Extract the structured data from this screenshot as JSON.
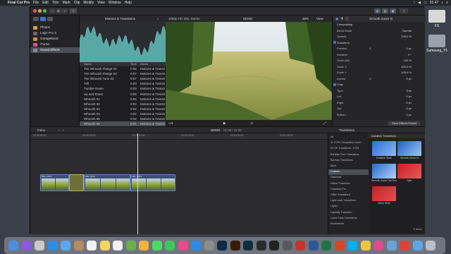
{
  "menubar": {
    "apple": "",
    "app": "Final Cut Pro",
    "items": [
      "File",
      "Edit",
      "Trim",
      "Mark",
      "Clip",
      "Modify",
      "View",
      "Window",
      "Help"
    ],
    "time": "01:47"
  },
  "toolbar": {
    "library_title": "Motions & Transitions",
    "format": "1080p HD 30p, Stereo",
    "clip_name": "DEMO",
    "zoom": "38%",
    "view": "View",
    "inspector_title": "Smooth Zoom In"
  },
  "libraries": {
    "items": [
      {
        "label": "Photos",
        "color": "#d9a23c"
      },
      {
        "label": "Logic Pro X",
        "color": "#6a6a6a"
      },
      {
        "label": "GarageBand",
        "color": "#e0892b"
      },
      {
        "label": "iTunes",
        "color": "#e64d8a"
      },
      {
        "label": "Sound Effects",
        "color": "#8a8a8a"
      }
    ],
    "selected": 4
  },
  "browser": {
    "columns": {
      "name": "Name",
      "time": "Time",
      "genre": "Genre"
    },
    "rows": [
      {
        "name": "Tire Whoosh Flange 02",
        "time": "0:05",
        "genre": "Motions & Transit"
      },
      {
        "name": "Tire Whoosh Flange 03",
        "time": "0:07",
        "genre": "Motions & Transit"
      },
      {
        "name": "Tire Whoosh Tone 02",
        "time": "0:07",
        "genre": "Motions & Transit"
      },
      {
        "name": "Trill",
        "time": "0:03",
        "genre": "Motions & Transit"
      },
      {
        "name": "Tumble Down",
        "time": "0:03",
        "genre": "Motions & Transit"
      },
      {
        "name": "Up and Down",
        "time": "0:06",
        "genre": "Motions & Transit"
      },
      {
        "name": "Whoosh 01",
        "time": "0:02",
        "genre": "Motions & Transit"
      },
      {
        "name": "Whoosh 02",
        "time": "0:02",
        "genre": "Motions & Transit"
      },
      {
        "name": "Whoosh 03",
        "time": "0:02",
        "genre": "Motions & Transit"
      },
      {
        "name": "Whoosh 04",
        "time": "0:02",
        "genre": "Motions & Transit"
      },
      {
        "name": "Whoosh 05",
        "time": "0:02",
        "genre": "Motions & Transit"
      },
      {
        "name": "Whoosh 06",
        "time": "0:01",
        "genre": "Motions & Transit"
      }
    ],
    "selected": 11
  },
  "viewer": {
    "timecode": "11"
  },
  "inspector": {
    "rows": [
      {
        "kind": "sec",
        "label": "Compositing"
      },
      {
        "kind": "row",
        "label": "Blend Mode",
        "value": "Normal"
      },
      {
        "kind": "row",
        "label": "Opacity",
        "value": "100,0 %"
      },
      {
        "kind": "sec",
        "label": "Transform",
        "check": true
      },
      {
        "kind": "row",
        "label": "Position",
        "value": "0 px",
        "value2": "X"
      },
      {
        "kind": "row",
        "label": "Rotation",
        "value": "0 °"
      },
      {
        "kind": "row",
        "label": "Scale (All)",
        "value": "100 %"
      },
      {
        "kind": "row",
        "label": "Scale X",
        "value": "100,0 %"
      },
      {
        "kind": "row",
        "label": "Scale Y",
        "value": "100,0 %"
      },
      {
        "kind": "row",
        "label": "Anchor",
        "value": "0 px",
        "value2": "X"
      },
      {
        "kind": "sec",
        "label": "Crop",
        "check": true
      },
      {
        "kind": "row",
        "label": "Type",
        "value": "Trim"
      },
      {
        "kind": "row",
        "label": "Left",
        "value": "0 px"
      },
      {
        "kind": "row",
        "label": "Right",
        "value": "0 px"
      },
      {
        "kind": "row",
        "label": "Top",
        "value": "0 px"
      },
      {
        "kind": "row",
        "label": "Bottom",
        "value": "0 px"
      }
    ],
    "save_label": "Save Effects Preset"
  },
  "timeline_bar": {
    "index": "Index",
    "project": "DEMO",
    "duration": "01:00 / 11:08"
  },
  "timeline": {
    "ticks": [
      "00:00:00:00",
      "00:00:05:00",
      "00:00:10:00",
      "00:00:15:00",
      "00:00:20:00",
      "00:00:25:00"
    ],
    "clips": [
      {
        "label": "IMG_0150"
      },
      {
        "label": "IMG_0151"
      },
      {
        "label": "IMG_0151"
      }
    ]
  },
  "transitions": {
    "header": "Transitions",
    "installed": "Installed Transitions",
    "categories": [
      "All",
      "11 FCPX Templates Contri...",
      "24 HK Transitions - EFM",
      "BarMan Free Transitions",
      "Barman Transitions",
      "Blurs",
      "Custom",
      "Dissolves",
      "Distort Transition",
      "Fxfactory Pro",
      "Glitch Transitions",
      "Light Leak Transitions",
      "Lights",
      "Liquidify Transition",
      "Luma Fade Transitions",
      "Movements"
    ],
    "selected": 6,
    "tiles": [
      {
        "label": "Rotation Slide",
        "color1": "#2a6fd6",
        "color2": "#8fb8ee"
      },
      {
        "label": "Smooth Zoom In",
        "color1": "#1f5fc4",
        "color2": "#9ec5f2"
      },
      {
        "label": "Smooth Zoom Out Text",
        "color1": "#2468cf",
        "color2": "#b7d3f5"
      },
      {
        "label": "Spin",
        "color1": "#c71f24",
        "color2": "#e85a5a"
      },
      {
        "label": "Wavy Slide",
        "color1": "#c71f24",
        "color2": "#e45050"
      }
    ],
    "items_count": "5 items"
  },
  "desktop": {
    "icons": [
      {
        "label": "FS"
      },
      {
        "label": "Samsung_T5"
      }
    ]
  },
  "dock": {
    "apps": [
      {
        "name": "finder-icon",
        "color": "#4a90e2"
      },
      {
        "name": "siri-icon",
        "color": "#8d5bd9"
      },
      {
        "name": "launchpad-icon",
        "color": "#c9c9c9"
      },
      {
        "name": "safari-icon",
        "color": "#2c8fe4"
      },
      {
        "name": "mail-icon",
        "color": "#5aa7ee"
      },
      {
        "name": "contacts-icon",
        "color": "#b58b62"
      },
      {
        "name": "calendar-icon",
        "color": "#f2f2f2"
      },
      {
        "name": "notes-icon",
        "color": "#f5d563"
      },
      {
        "name": "reminders-icon",
        "color": "#f2f2f2"
      },
      {
        "name": "maps-icon",
        "color": "#6ab04c"
      },
      {
        "name": "photos-icon",
        "color": "#f2b33d"
      },
      {
        "name": "messages-icon",
        "color": "#4cd964"
      },
      {
        "name": "facetime-icon",
        "color": "#3ec65a"
      },
      {
        "name": "itunes-icon",
        "color": "#e64d8a"
      },
      {
        "name": "app-store-icon",
        "color": "#2e8ae6"
      },
      {
        "name": "preferences-icon",
        "color": "#8c8c8c"
      },
      {
        "name": "photoshop-icon",
        "color": "#0b2b47"
      },
      {
        "name": "illustrator-icon",
        "color": "#3b1a05"
      },
      {
        "name": "lightroom-icon",
        "color": "#0e2f3d"
      },
      {
        "name": "final-cut-icon",
        "color": "#2b2b2b"
      },
      {
        "name": "terminal-icon",
        "color": "#222222"
      },
      {
        "name": "motion-icon",
        "color": "#5a5a5a"
      },
      {
        "name": "filezilla-icon",
        "color": "#c8332a"
      },
      {
        "name": "word-icon",
        "color": "#2b579a"
      },
      {
        "name": "excel-icon",
        "color": "#217346"
      },
      {
        "name": "powerpoint-icon",
        "color": "#d24726"
      },
      {
        "name": "skype-icon",
        "color": "#00aff0"
      },
      {
        "name": "chrome-icon",
        "color": "#e8c83b"
      },
      {
        "name": "itunes2-icon",
        "color": "#d94e8f"
      },
      {
        "name": "globe-icon",
        "color": "#6ba1d6"
      },
      {
        "name": "chrome2-icon",
        "color": "#db4437"
      },
      {
        "name": "folder-icon",
        "color": "#5aa6e8"
      },
      {
        "name": "trash-icon",
        "color": "#b9bec7"
      }
    ]
  }
}
